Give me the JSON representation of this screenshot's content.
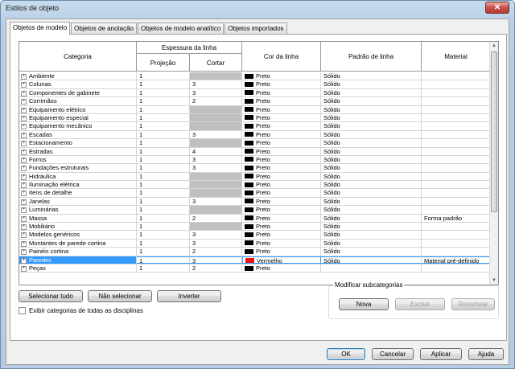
{
  "window": {
    "title": "Estilos de objeto",
    "close_label": "✕"
  },
  "tabs": [
    {
      "label": "Objetos de modelo",
      "active": true
    },
    {
      "label": "Objetos de anotação",
      "active": false
    },
    {
      "label": "Objetos de modelo analítico",
      "active": false
    },
    {
      "label": "Objetos importados",
      "active": false
    }
  ],
  "grid": {
    "headers": {
      "category": "Categoria",
      "line_weight": "Espessura da linha",
      "projection": "Projeção",
      "cut": "Cortar",
      "line_color": "Cor da linha",
      "line_pattern": "Padrão de linha",
      "material": "Material"
    },
    "rows": [
      {
        "category": "Ambiente",
        "projection": "1",
        "cut": "",
        "cut_grey": true,
        "color": "Preto",
        "color_hex": "#000000",
        "pattern": "Sólido",
        "material": ""
      },
      {
        "category": "Colunas",
        "projection": "1",
        "cut": "3",
        "cut_grey": false,
        "color": "Preto",
        "color_hex": "#000000",
        "pattern": "Sólido",
        "material": ""
      },
      {
        "category": "Componentes de gabinete",
        "projection": "1",
        "cut": "3",
        "cut_grey": false,
        "color": "Preto",
        "color_hex": "#000000",
        "pattern": "Sólido",
        "material": ""
      },
      {
        "category": "Corrimãos",
        "projection": "1",
        "cut": "2",
        "cut_grey": false,
        "color": "Preto",
        "color_hex": "#000000",
        "pattern": "Sólido",
        "material": ""
      },
      {
        "category": "Equipamento elétrico",
        "projection": "1",
        "cut": "",
        "cut_grey": true,
        "color": "Preto",
        "color_hex": "#000000",
        "pattern": "Sólido",
        "material": ""
      },
      {
        "category": "Equipamento especial",
        "projection": "1",
        "cut": "",
        "cut_grey": true,
        "color": "Preto",
        "color_hex": "#000000",
        "pattern": "Sólido",
        "material": ""
      },
      {
        "category": "Equipamento mecânico",
        "projection": "1",
        "cut": "",
        "cut_grey": true,
        "color": "Preto",
        "color_hex": "#000000",
        "pattern": "Sólido",
        "material": ""
      },
      {
        "category": "Escadas",
        "projection": "1",
        "cut": "3",
        "cut_grey": false,
        "color": "Preto",
        "color_hex": "#000000",
        "pattern": "Sólido",
        "material": ""
      },
      {
        "category": "Estacionamento",
        "projection": "1",
        "cut": "",
        "cut_grey": true,
        "color": "Preto",
        "color_hex": "#000000",
        "pattern": "Sólido",
        "material": ""
      },
      {
        "category": "Estradas",
        "projection": "1",
        "cut": "4",
        "cut_grey": false,
        "color": "Preto",
        "color_hex": "#000000",
        "pattern": "Sólido",
        "material": ""
      },
      {
        "category": "Forros",
        "projection": "1",
        "cut": "3",
        "cut_grey": false,
        "color": "Preto",
        "color_hex": "#000000",
        "pattern": "Sólido",
        "material": ""
      },
      {
        "category": "Fundações estruturais",
        "projection": "1",
        "cut": "3",
        "cut_grey": false,
        "color": "Preto",
        "color_hex": "#000000",
        "pattern": "Sólido",
        "material": ""
      },
      {
        "category": "Hidráulica",
        "projection": "1",
        "cut": "",
        "cut_grey": true,
        "color": "Preto",
        "color_hex": "#000000",
        "pattern": "Sólido",
        "material": ""
      },
      {
        "category": "Iluminação elétrica",
        "projection": "1",
        "cut": "",
        "cut_grey": true,
        "color": "Preto",
        "color_hex": "#000000",
        "pattern": "Sólido",
        "material": ""
      },
      {
        "category": "Itens de detalhe",
        "projection": "1",
        "cut": "",
        "cut_grey": true,
        "color": "Preto",
        "color_hex": "#000000",
        "pattern": "Sólido",
        "material": ""
      },
      {
        "category": "Janelas",
        "projection": "1",
        "cut": "3",
        "cut_grey": false,
        "color": "Preto",
        "color_hex": "#000000",
        "pattern": "Sólido",
        "material": ""
      },
      {
        "category": "Luminárias",
        "projection": "1",
        "cut": "",
        "cut_grey": true,
        "color": "Preto",
        "color_hex": "#000000",
        "pattern": "Sólido",
        "material": ""
      },
      {
        "category": "Massa",
        "projection": "1",
        "cut": "2",
        "cut_grey": false,
        "color": "Preto",
        "color_hex": "#000000",
        "pattern": "Sólido",
        "material": "Forma padrão"
      },
      {
        "category": "Mobiliário",
        "projection": "1",
        "cut": "",
        "cut_grey": true,
        "color": "Preto",
        "color_hex": "#000000",
        "pattern": "Sólido",
        "material": ""
      },
      {
        "category": "Modelos genéricos",
        "projection": "1",
        "cut": "3",
        "cut_grey": false,
        "color": "Preto",
        "color_hex": "#000000",
        "pattern": "Sólido",
        "material": ""
      },
      {
        "category": "Montantes de parede cortina",
        "projection": "1",
        "cut": "3",
        "cut_grey": false,
        "color": "Preto",
        "color_hex": "#000000",
        "pattern": "Sólido",
        "material": ""
      },
      {
        "category": "Painéis cortina",
        "projection": "1",
        "cut": "2",
        "cut_grey": false,
        "color": "Preto",
        "color_hex": "#000000",
        "pattern": "Sólido",
        "material": ""
      },
      {
        "category": "Paredes",
        "projection": "1",
        "cut": "3",
        "cut_grey": false,
        "color": "Vermelho",
        "color_hex": "#ee1111",
        "pattern": "Sólido",
        "material": "Material pré-definido",
        "selected": true
      },
      {
        "category": "Peças",
        "projection": "1",
        "cut": "2",
        "cut_grey": false,
        "color": "Preto",
        "color_hex": "#000000",
        "pattern": "",
        "material": ""
      }
    ]
  },
  "buttons": {
    "select_all": "Selecionar tudo",
    "select_none": "Não selecionar",
    "invert": "Inverter",
    "new": "Nova",
    "delete": "Excluir",
    "rename": "Renomear",
    "ok": "OK",
    "cancel": "Cancelar",
    "apply": "Aplicar",
    "help": "Ajuda"
  },
  "checkbox": {
    "label": "Exibir categorias de todas as disciplinas",
    "checked": false
  },
  "subcategories": {
    "title": "Modificar subcategorias"
  }
}
